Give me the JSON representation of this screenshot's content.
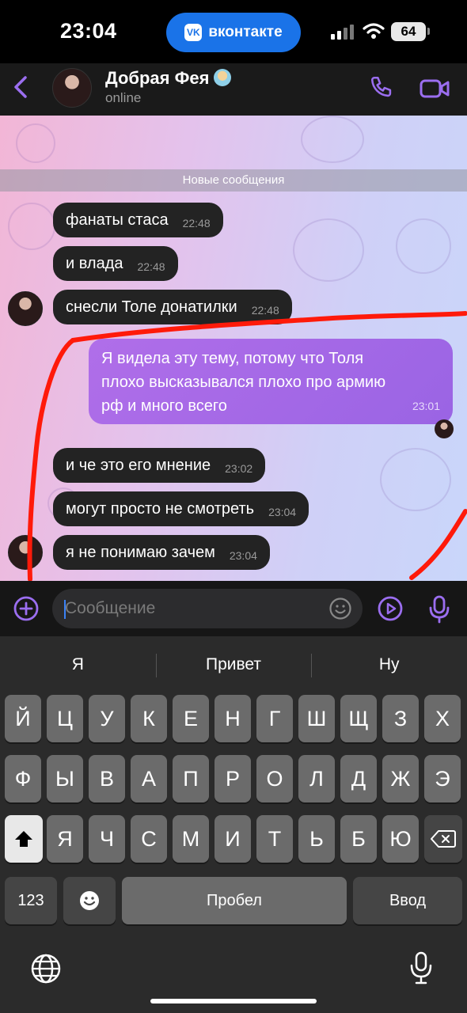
{
  "status_bar": {
    "time": "23:04",
    "app_pill_label": "вконтакте",
    "battery": "64"
  },
  "chat_header": {
    "contact_name": "Добрая Фея",
    "status": "online"
  },
  "chat": {
    "new_messages_label": "Новые сообщения",
    "messages": [
      {
        "text": "фанаты стаса",
        "time": "22:48",
        "direction": "incoming"
      },
      {
        "text": "и влада",
        "time": "22:48",
        "direction": "incoming"
      },
      {
        "text": "снесли Толе донатилки",
        "time": "22:48",
        "direction": "incoming"
      },
      {
        "text": "Я видела эту тему, потому что Толя плохо высказывался плохо про армию рф и много всего",
        "lines": [
          "Я видела эту тему, потому что Толя",
          "плохо высказывался плохо про армию",
          "рф и много всего"
        ],
        "time": "23:01",
        "direction": "outgoing"
      },
      {
        "text": "и че это его мнение",
        "time": "23:02",
        "direction": "incoming"
      },
      {
        "text": "могут просто не смотреть",
        "time": "23:04",
        "direction": "incoming"
      },
      {
        "text": "я не понимаю зачем",
        "time": "23:04",
        "direction": "incoming"
      }
    ]
  },
  "input": {
    "placeholder": "Сообщение",
    "value": ""
  },
  "keyboard": {
    "suggestions": [
      "Я",
      "Привет",
      "Ну"
    ],
    "row1": [
      "Й",
      "Ц",
      "У",
      "К",
      "Е",
      "Н",
      "Г",
      "Ш",
      "Щ",
      "З",
      "Х"
    ],
    "row2": [
      "Ф",
      "Ы",
      "В",
      "А",
      "П",
      "Р",
      "О",
      "Л",
      "Д",
      "Ж",
      "Э"
    ],
    "row3": [
      "Я",
      "Ч",
      "С",
      "М",
      "И",
      "Т",
      "Ь",
      "Б",
      "Ю"
    ],
    "numbers_key": "123",
    "space_key": "Пробел",
    "return_key": "Ввод"
  },
  "colors": {
    "accent": "#9b6ef0",
    "outgoing_bubble": "#a469e6",
    "incoming_bubble": "#232323",
    "annotation_red": "#ff1a0a"
  }
}
